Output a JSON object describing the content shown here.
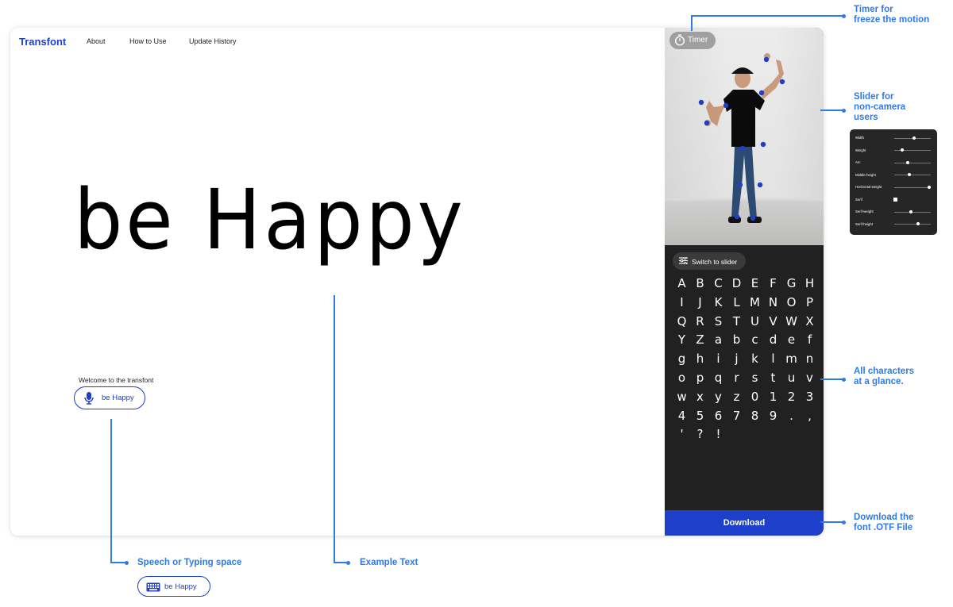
{
  "nav": {
    "brand": "Transfont",
    "links": [
      "About",
      "How to Use",
      "Update History"
    ]
  },
  "main": {
    "sample_text": "be Happy",
    "welcome": "Welcome to the transfont",
    "input_value": "be Happy"
  },
  "panel": {
    "timer_label": "Timer",
    "switch_label": "Switch to slider",
    "glyphs": [
      "A",
      "B",
      "C",
      "D",
      "E",
      "F",
      "G",
      "H",
      "I",
      "J",
      "K",
      "L",
      "M",
      "N",
      "O",
      "P",
      "Q",
      "R",
      "S",
      "T",
      "U",
      "V",
      "W",
      "X",
      "Y",
      "Z",
      "a",
      "b",
      "c",
      "d",
      "e",
      "f",
      "g",
      "h",
      "i",
      "j",
      "k",
      "l",
      "m",
      "n",
      "o",
      "p",
      "q",
      "r",
      "s",
      "t",
      "u",
      "v",
      "w",
      "x",
      "y",
      "z",
      "0",
      "1",
      "2",
      "3",
      "4",
      "5",
      "6",
      "7",
      "8",
      "9",
      ".",
      ",",
      "'",
      "?",
      "!"
    ],
    "download_label": "Download"
  },
  "slider_panel": {
    "rows": [
      {
        "label": "Width",
        "type": "slider",
        "value": 0.55
      },
      {
        "label": "Weight",
        "type": "slider",
        "value": 0.22
      },
      {
        "label": "Arc",
        "type": "slider",
        "value": 0.38
      },
      {
        "label": "Middle-height",
        "type": "slider",
        "value": 0.42
      },
      {
        "label": "Horizontal-weight",
        "type": "slider",
        "value": 0.95
      },
      {
        "label": "Serif",
        "type": "checkbox",
        "value": true
      },
      {
        "label": "Serif-weight",
        "type": "slider",
        "value": 0.45
      },
      {
        "label": "Serif-height",
        "type": "slider",
        "value": 0.65
      }
    ]
  },
  "annotations": {
    "timer": [
      "Timer for",
      "freeze the motion"
    ],
    "slider": [
      "Slider for",
      "non-camera",
      "users"
    ],
    "characters": [
      "All characters",
      "at a glance."
    ],
    "download": [
      "Download the",
      "font .OTF File"
    ],
    "speech": "Speech or Typing space",
    "example": "Example Text"
  },
  "bottom_input_value": "be Happy",
  "colors": {
    "accent": "#1d3fc9",
    "annotation": "#2f7ae6",
    "panel_bg": "#212121"
  }
}
